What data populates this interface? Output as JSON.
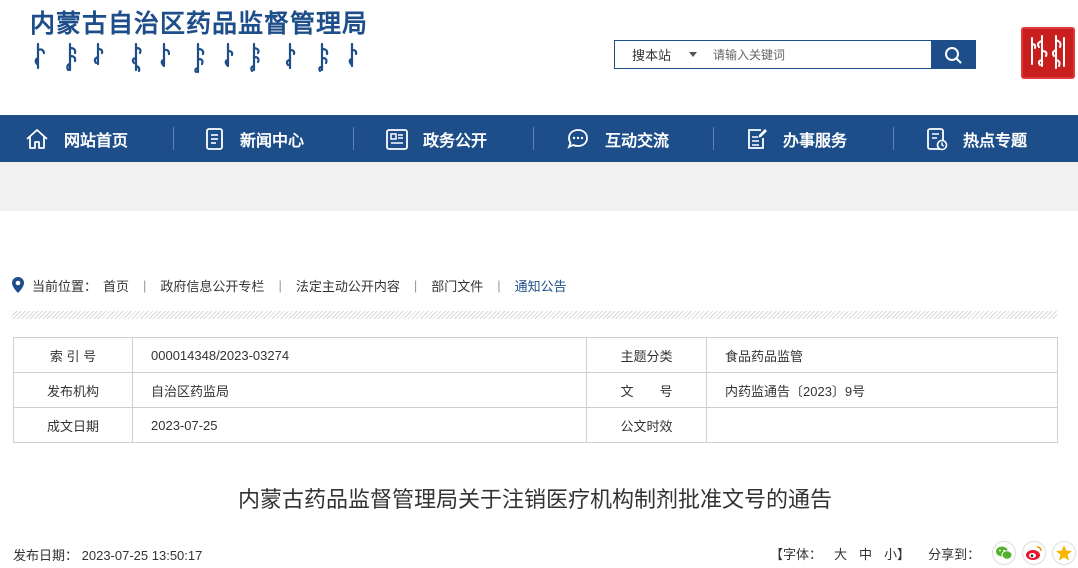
{
  "header": {
    "site_title": "内蒙古自治区药品监督管理局",
    "search": {
      "scope_label": "搜本站",
      "placeholder": "请输入关键词"
    }
  },
  "nav": {
    "items": [
      {
        "label": "网站首页",
        "icon": "home-icon"
      },
      {
        "label": "新闻中心",
        "icon": "news-icon"
      },
      {
        "label": "政务公开",
        "icon": "document-icon"
      },
      {
        "label": "互动交流",
        "icon": "chat-icon"
      },
      {
        "label": "办事服务",
        "icon": "edit-document-icon"
      },
      {
        "label": "热点专题",
        "icon": "topic-icon"
      }
    ]
  },
  "breadcrumb": {
    "label": "当前位置：",
    "items": [
      "首页",
      "政府信息公开专栏",
      "法定主动公开内容",
      "部门文件",
      "通知公告"
    ]
  },
  "info": {
    "index_label": "索 引 号",
    "index_value": "000014348/2023-03274",
    "topic_label": "主题分类",
    "topic_value": "食品药品监管",
    "publisher_label": "发布机构",
    "publisher_value": "自治区药监局",
    "docno_label": "文　　号",
    "docno_value": "内药监通告〔2023〕9号",
    "date_label": "成文日期",
    "date_value": "2023-07-25",
    "time_label": "公文时效",
    "time_value": ""
  },
  "article": {
    "title": "内蒙古药品监督管理局关于注销医疗机构制剂批准文号的通告",
    "publish_label": "发布日期：",
    "publish_value": "2023-07-25 13:50:17",
    "font_label": "【字体：",
    "font_large": "大",
    "font_medium": "中",
    "font_small": "小】",
    "share_label": "分享到："
  },
  "colors": {
    "brand": "#1d4e8a",
    "seal": "#c81e1e",
    "band": "#f1f1f1"
  }
}
